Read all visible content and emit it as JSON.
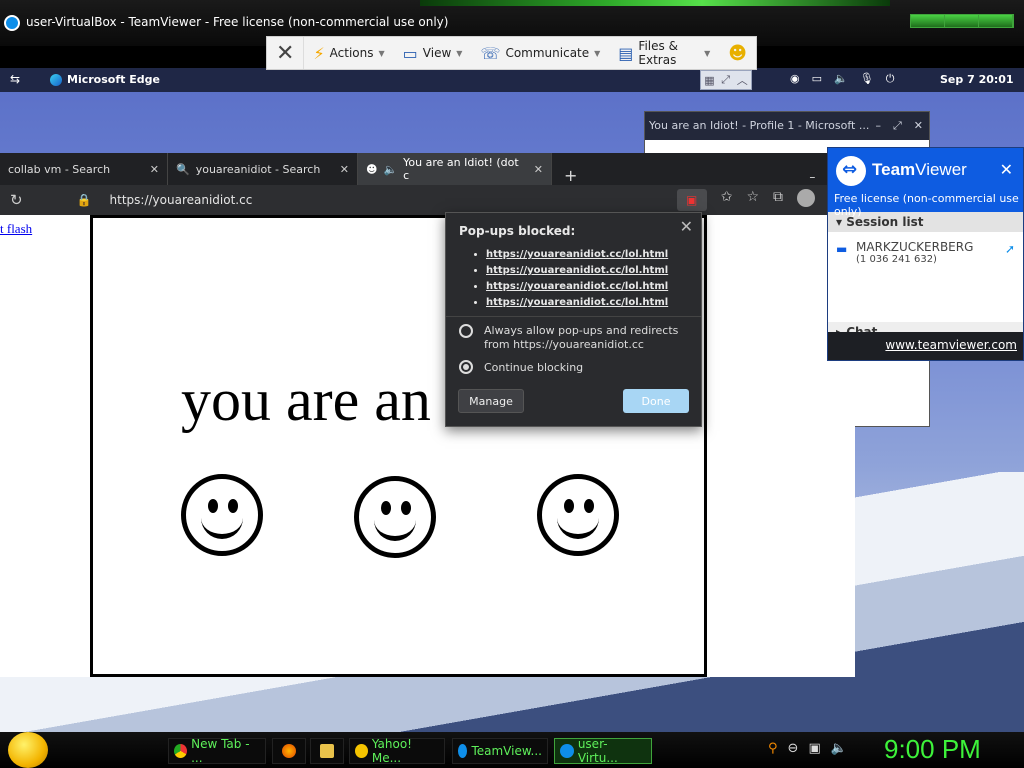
{
  "teamviewer_window": {
    "title": "user-VirtualBox - TeamViewer - Free license (non-commercial use only)",
    "toolbar": {
      "actions": "Actions",
      "view": "View",
      "communicate": "Communicate",
      "files_extras": "Files & Extras"
    }
  },
  "remote_topbar": {
    "app_name": "Microsoft Edge",
    "date_time": "Sep 7  20:01"
  },
  "background_window": {
    "title": "You are an Idiot! - Profile 1 - Microsoft ..."
  },
  "browser": {
    "tabs": [
      {
        "label": "collab vm - Search"
      },
      {
        "label": "youareanidiot - Search"
      },
      {
        "label": "You are an Idiot! (dot c"
      }
    ],
    "url": "https://youareanidiot.cc",
    "page_link": "t flash",
    "page_big_text": "you are an"
  },
  "popup": {
    "heading": "Pop-ups blocked:",
    "links": [
      "https://youareanidiot.cc/lol.html",
      "https://youareanidiot.cc/lol.html",
      "https://youareanidiot.cc/lol.html",
      "https://youareanidiot.cc/lol.html"
    ],
    "option_allow": "Always allow pop-ups and redirects from https://youareanidiot.cc",
    "option_block": "Continue blocking",
    "manage": "Manage",
    "done": "Done"
  },
  "tv_panel": {
    "brand_a": "Team",
    "brand_b": "Viewer",
    "license": "Free license (non-commercial use only)",
    "session_list": "Session list",
    "session_name": "MARKZUCKERBERG",
    "session_id": "(1 036 241 632)",
    "chat": "Chat",
    "link": "www.teamviewer.com"
  },
  "taskbar": {
    "items": [
      {
        "label": "New Tab - ..."
      },
      {
        "label": "Yahoo! Me..."
      },
      {
        "label": "TeamView..."
      },
      {
        "label": "user-Virtu..."
      }
    ],
    "clock": "9:00 PM"
  },
  "colors": {
    "teamviewer_blue": "#0e5ce1",
    "taskbar_green": "#3df23a"
  }
}
